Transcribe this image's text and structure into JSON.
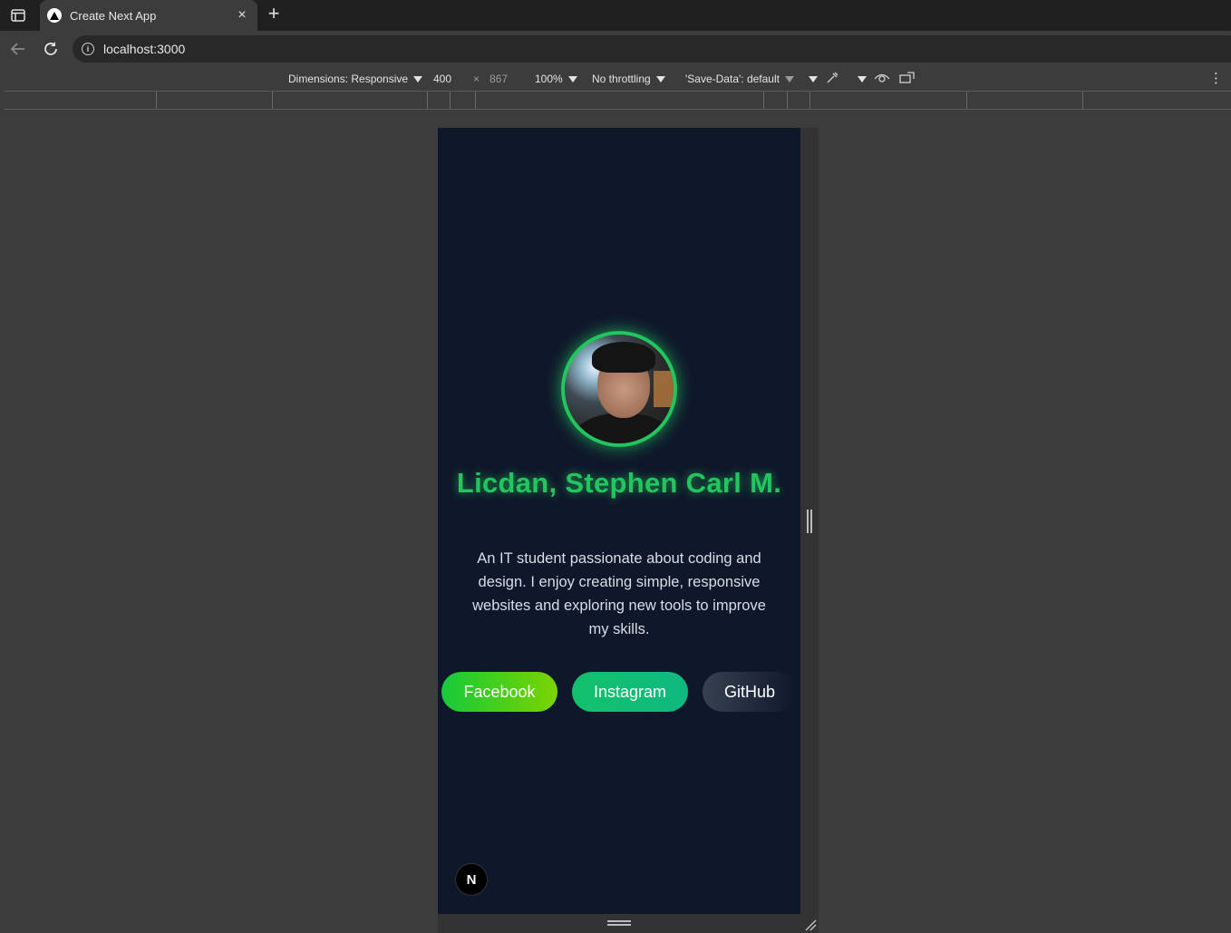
{
  "browser": {
    "tab": {
      "title": "Create Next App",
      "close": "×"
    },
    "new_tab": "+",
    "address": {
      "url": "localhost:3000"
    },
    "info_icon": "i"
  },
  "devtools": {
    "dimensions_label": "Dimensions: Responsive",
    "width": "400",
    "times": "×",
    "height": "867",
    "zoom": "100%",
    "throttling": "No throttling",
    "save_data": "'Save-Data': default",
    "more": "⋮"
  },
  "profile": {
    "name": "Licdan, Stephen Carl M.",
    "bio": "An IT student passionate about coding and design. I enjoy creating simple, responsive websites and exploring new tools to improve my skills.",
    "accent_color": "#22c55e",
    "background_color": "#0f172a"
  },
  "links": {
    "facebook": "Facebook",
    "instagram": "Instagram",
    "github": "GitHub"
  },
  "next_badge": "N"
}
